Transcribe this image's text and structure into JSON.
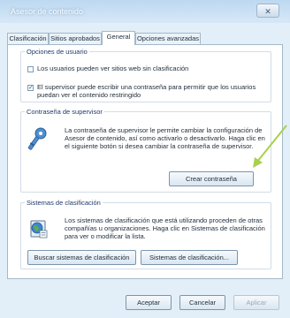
{
  "window": {
    "title": "Asesor de contenido",
    "close_glyph": "✕"
  },
  "tabs": [
    {
      "label": "Clasificación",
      "active": false
    },
    {
      "label": "Sitios aprobados",
      "active": false
    },
    {
      "label": "General",
      "active": true
    },
    {
      "label": "Opciones avanzadas",
      "active": false
    }
  ],
  "user_options": {
    "legend": "Opciones de usuario",
    "option1": {
      "label": "Los usuarios pueden ver sitios web sin clasificación",
      "checked": false
    },
    "option2": {
      "label": "El supervisor puede escribir una contraseña para permitir que los usuarios puedan ver el contenido restringido",
      "checked": true
    }
  },
  "supervisor": {
    "legend": "Contraseña de supervisor",
    "description": "La contraseña de supervisor le permite cambiar la configuración de Asesor de contenido, así como activarlo o desactivarlo. Haga clic en el siguiente botón si desea cambiar la contraseña de supervisor.",
    "icon": "key-icon",
    "button": "Crear contraseña"
  },
  "rating_systems": {
    "legend": "Sistemas de clasificación",
    "description": "Los sistemas de clasificación que está utilizando proceden de otras compañías u organizaciones. Haga clic en Sistemas de clasificación para ver o modificar la lista.",
    "icon": "globe-icon",
    "find_button": "Buscar sistemas de clasificación",
    "systems_button": "Sistemas de clasificación..."
  },
  "footer": {
    "accept": "Aceptar",
    "cancel": "Cancelar",
    "apply": "Aplicar"
  },
  "colors": {
    "annotation_arrow": "#a8d04a",
    "title_bar": "#bcd8f1"
  }
}
